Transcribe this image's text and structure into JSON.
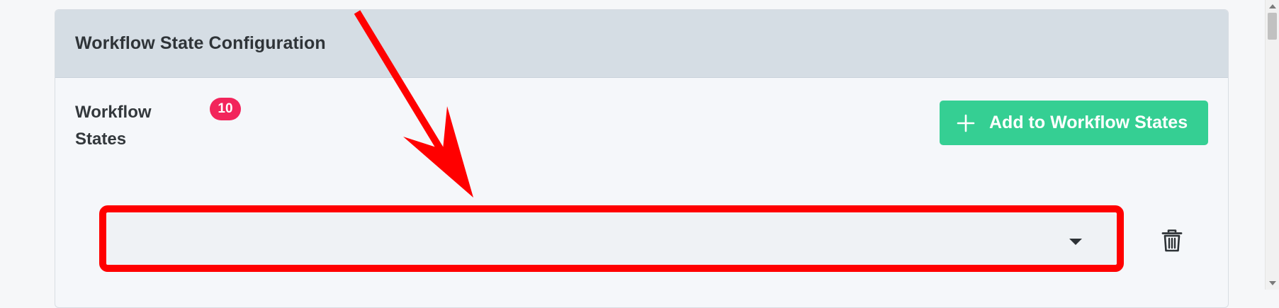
{
  "card": {
    "title": "Workflow State Configuration"
  },
  "workflow_states": {
    "label": "Workflow States",
    "count": "10",
    "add_button_label": "Add to Workflow States",
    "select_value": ""
  },
  "icons": {
    "add": "plus-icon",
    "dropdown": "chevron-down-icon",
    "delete": "trash-icon"
  },
  "colors": {
    "header_bg": "#d5dde4",
    "badge": "#f2255b",
    "add_button": "#35cf93",
    "annotation": "#ff0000"
  }
}
